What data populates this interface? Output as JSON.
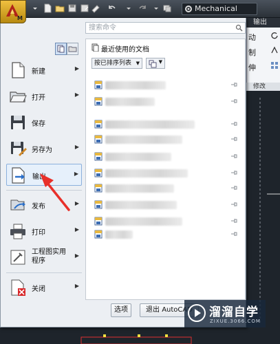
{
  "app": {
    "logo_letter": "M",
    "workspace": "Mechanical"
  },
  "ribbon": {
    "tab_label": "输出",
    "items": [
      "动",
      "制",
      "伸"
    ],
    "footer": "修改"
  },
  "search": {
    "placeholder": "搜索命令"
  },
  "menu": {
    "items": [
      {
        "label": "新建",
        "icon": "new-file-icon",
        "has_submenu": true
      },
      {
        "label": "打开",
        "icon": "folder-open-icon",
        "has_submenu": true
      },
      {
        "label": "保存",
        "icon": "save-disk-icon",
        "has_submenu": false
      },
      {
        "label": "另存为",
        "icon": "save-as-icon",
        "has_submenu": true
      },
      {
        "label": "输出",
        "icon": "export-icon",
        "has_submenu": true
      },
      {
        "label": "发布",
        "icon": "publish-icon",
        "has_submenu": true
      },
      {
        "label": "打印",
        "icon": "printer-icon",
        "has_submenu": true
      },
      {
        "label": "工程图实用程序",
        "label_line1": "工程图实用",
        "label_line2": "程序",
        "icon": "drawing-utilities-icon",
        "has_submenu": true
      },
      {
        "label": "关闭",
        "icon": "close-file-icon",
        "has_submenu": true
      }
    ]
  },
  "recent": {
    "title": "最近使用的文档",
    "sort_label": "按已排序列表",
    "documents_count_visible": 10
  },
  "buttons": {
    "options": "选项",
    "exit": "退出 AutoCAD"
  },
  "watermark": {
    "title": "溜溜自学",
    "url": "ZIXUE.3066.COM"
  },
  "colors": {
    "accent": "#f0c040",
    "annotation_arrow": "#e8302a"
  }
}
